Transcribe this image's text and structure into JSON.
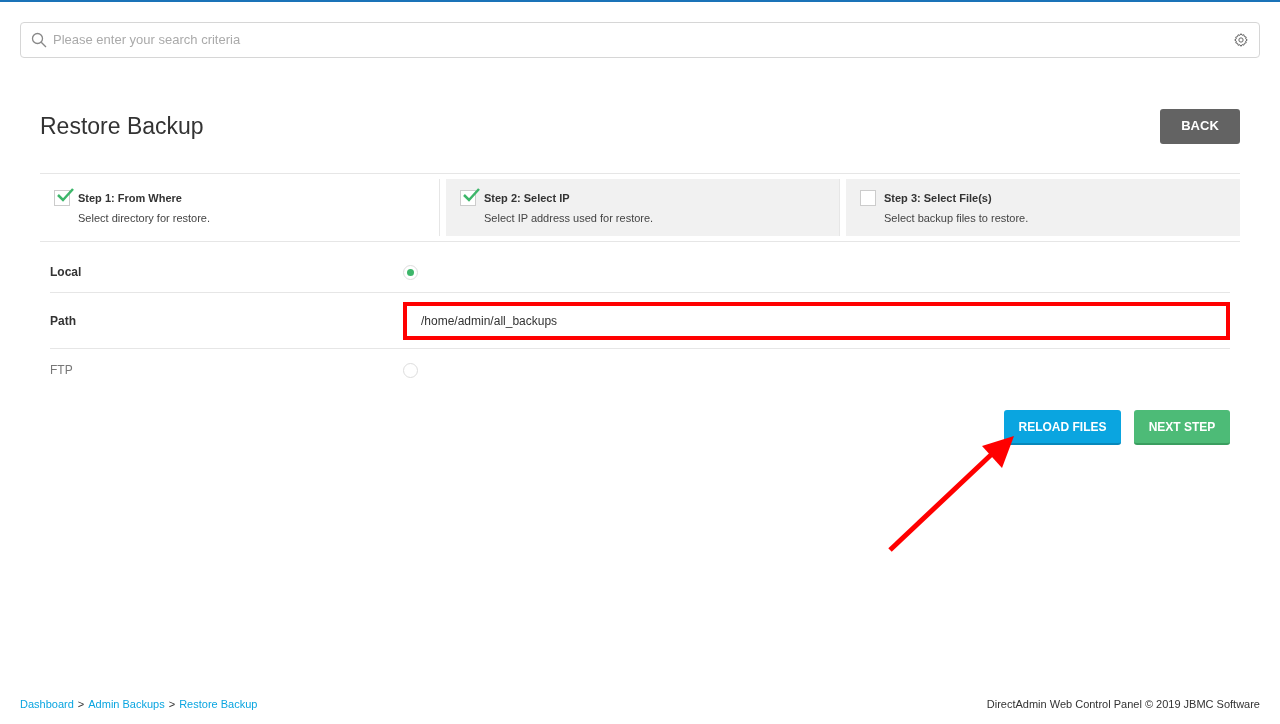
{
  "search": {
    "placeholder": "Please enter your search criteria"
  },
  "page_title": "Restore Backup",
  "back_button": "BACK",
  "steps": [
    {
      "title": "Step 1: From Where",
      "description": "Select directory for restore.",
      "checked": true,
      "selected": true
    },
    {
      "title": "Step 2: Select IP",
      "description": "Select IP address used for restore.",
      "checked": true,
      "selected": false
    },
    {
      "title": "Step 3: Select File(s)",
      "description": "Select backup files to restore.",
      "checked": false,
      "selected": false
    }
  ],
  "form_rows": [
    {
      "kind": "radio",
      "label": "Local",
      "selected": true
    },
    {
      "kind": "text",
      "label": "Path",
      "value": "/home/admin/all_backups",
      "highlighted": true
    },
    {
      "kind": "radio",
      "label": "FTP",
      "selected": false
    }
  ],
  "action_buttons": [
    {
      "label": "RELOAD FILES",
      "kind": "primary"
    },
    {
      "label": "NEXT STEP",
      "kind": "success"
    }
  ],
  "breadcrumb": {
    "separator": ">",
    "items": [
      "Dashboard",
      "Admin Backups",
      "Restore Backup"
    ]
  },
  "footer": "DirectAdmin Web Control Panel © 2019 JBMC Software"
}
